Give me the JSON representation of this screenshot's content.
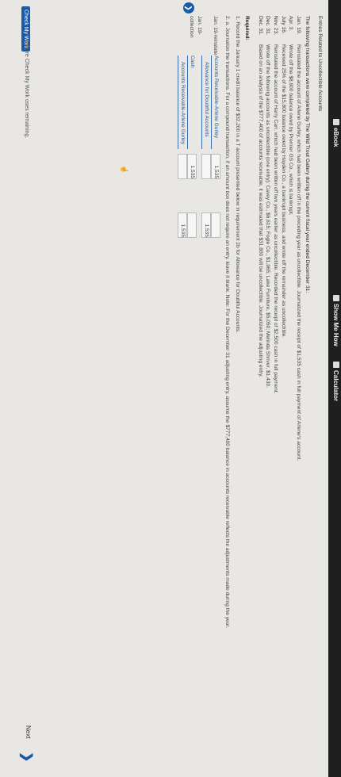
{
  "toolbar": {
    "ebook": "eBook",
    "show_me_how": "Show Me How",
    "calculator": "Calculator"
  },
  "problem": {
    "title": "Entries Related to Uncollectible Accounts",
    "intro": "The following transactions were completed by The Wild Trout Gallery during the current fiscal year ended December 31:",
    "transactions": [
      {
        "date": "Jan. 19.",
        "text": "Reinstated the account of Arlene Gurley, which had been written off in the preceding year as uncollectible. Journalized the receipt of $1,535 cash in full payment of Arlene's account."
      },
      {
        "date": "Apr. 3.",
        "text": "Wrote off the $8,800 balance owed by Premier GS Co., which is bankrupt."
      },
      {
        "date": "July 16.",
        "text": "Received 25% of the $15,800 balance owed by Hayden Co., a bankrupt business, and wrote off the remainder as uncollectible."
      },
      {
        "date": "Nov. 23.",
        "text": "Reinstated the account of Harry Carr, which had been written off two years earlier as uncollectible. Recorded the receipt of $2,500 cash in full payment."
      },
      {
        "date": "Dec. 31.",
        "text": "Wrote off the following accounts as uncollectible (one entry): Cavey Co., $6,615; Fogle Co., $1,965; Lake Furniture, $5,050; Melinda Shriver, $1,430."
      },
      {
        "date": "Dec. 31.",
        "text": "Based on an analysis of the $777,400 of accounts receivable, it was estimated that $31,800 will be uncollectible. Journalized the adjusting entry."
      }
    ]
  },
  "required": {
    "heading": "Required:",
    "item1": "1. Record the January 1 credit balance of $32,200 in a T account presented below in requirement 2b for Allowance for Doubtful Accounts.",
    "item2a": "2. a. Journalize the transactions. For a compound transaction, if an amount box does not require an entry, leave it blank. Note: For the December 31 adjusting entry, assume the $777,400 balance in accounts receivable reflects the adjustments made during the year."
  },
  "journal": {
    "rows": [
      {
        "date": "Jan. 19-reinstate",
        "account": "Accounts Receivable-Arlene Gurley",
        "debit": "1,535",
        "credit": ""
      },
      {
        "date": "",
        "account": "Allowance for Doubtful Accounts",
        "debit": "",
        "credit": "1,535"
      },
      {
        "date": "Jan. 19-collection",
        "account": "Cash",
        "debit": "1,535",
        "credit": ""
      },
      {
        "date": "",
        "account": "Accounts Receivable-Arlene Gurley",
        "debit": "",
        "credit": "1,535"
      }
    ]
  },
  "footer": {
    "check_my_work": "Check My Work",
    "remaining": "3 more Check My Work uses remaining.",
    "next": "Next"
  }
}
